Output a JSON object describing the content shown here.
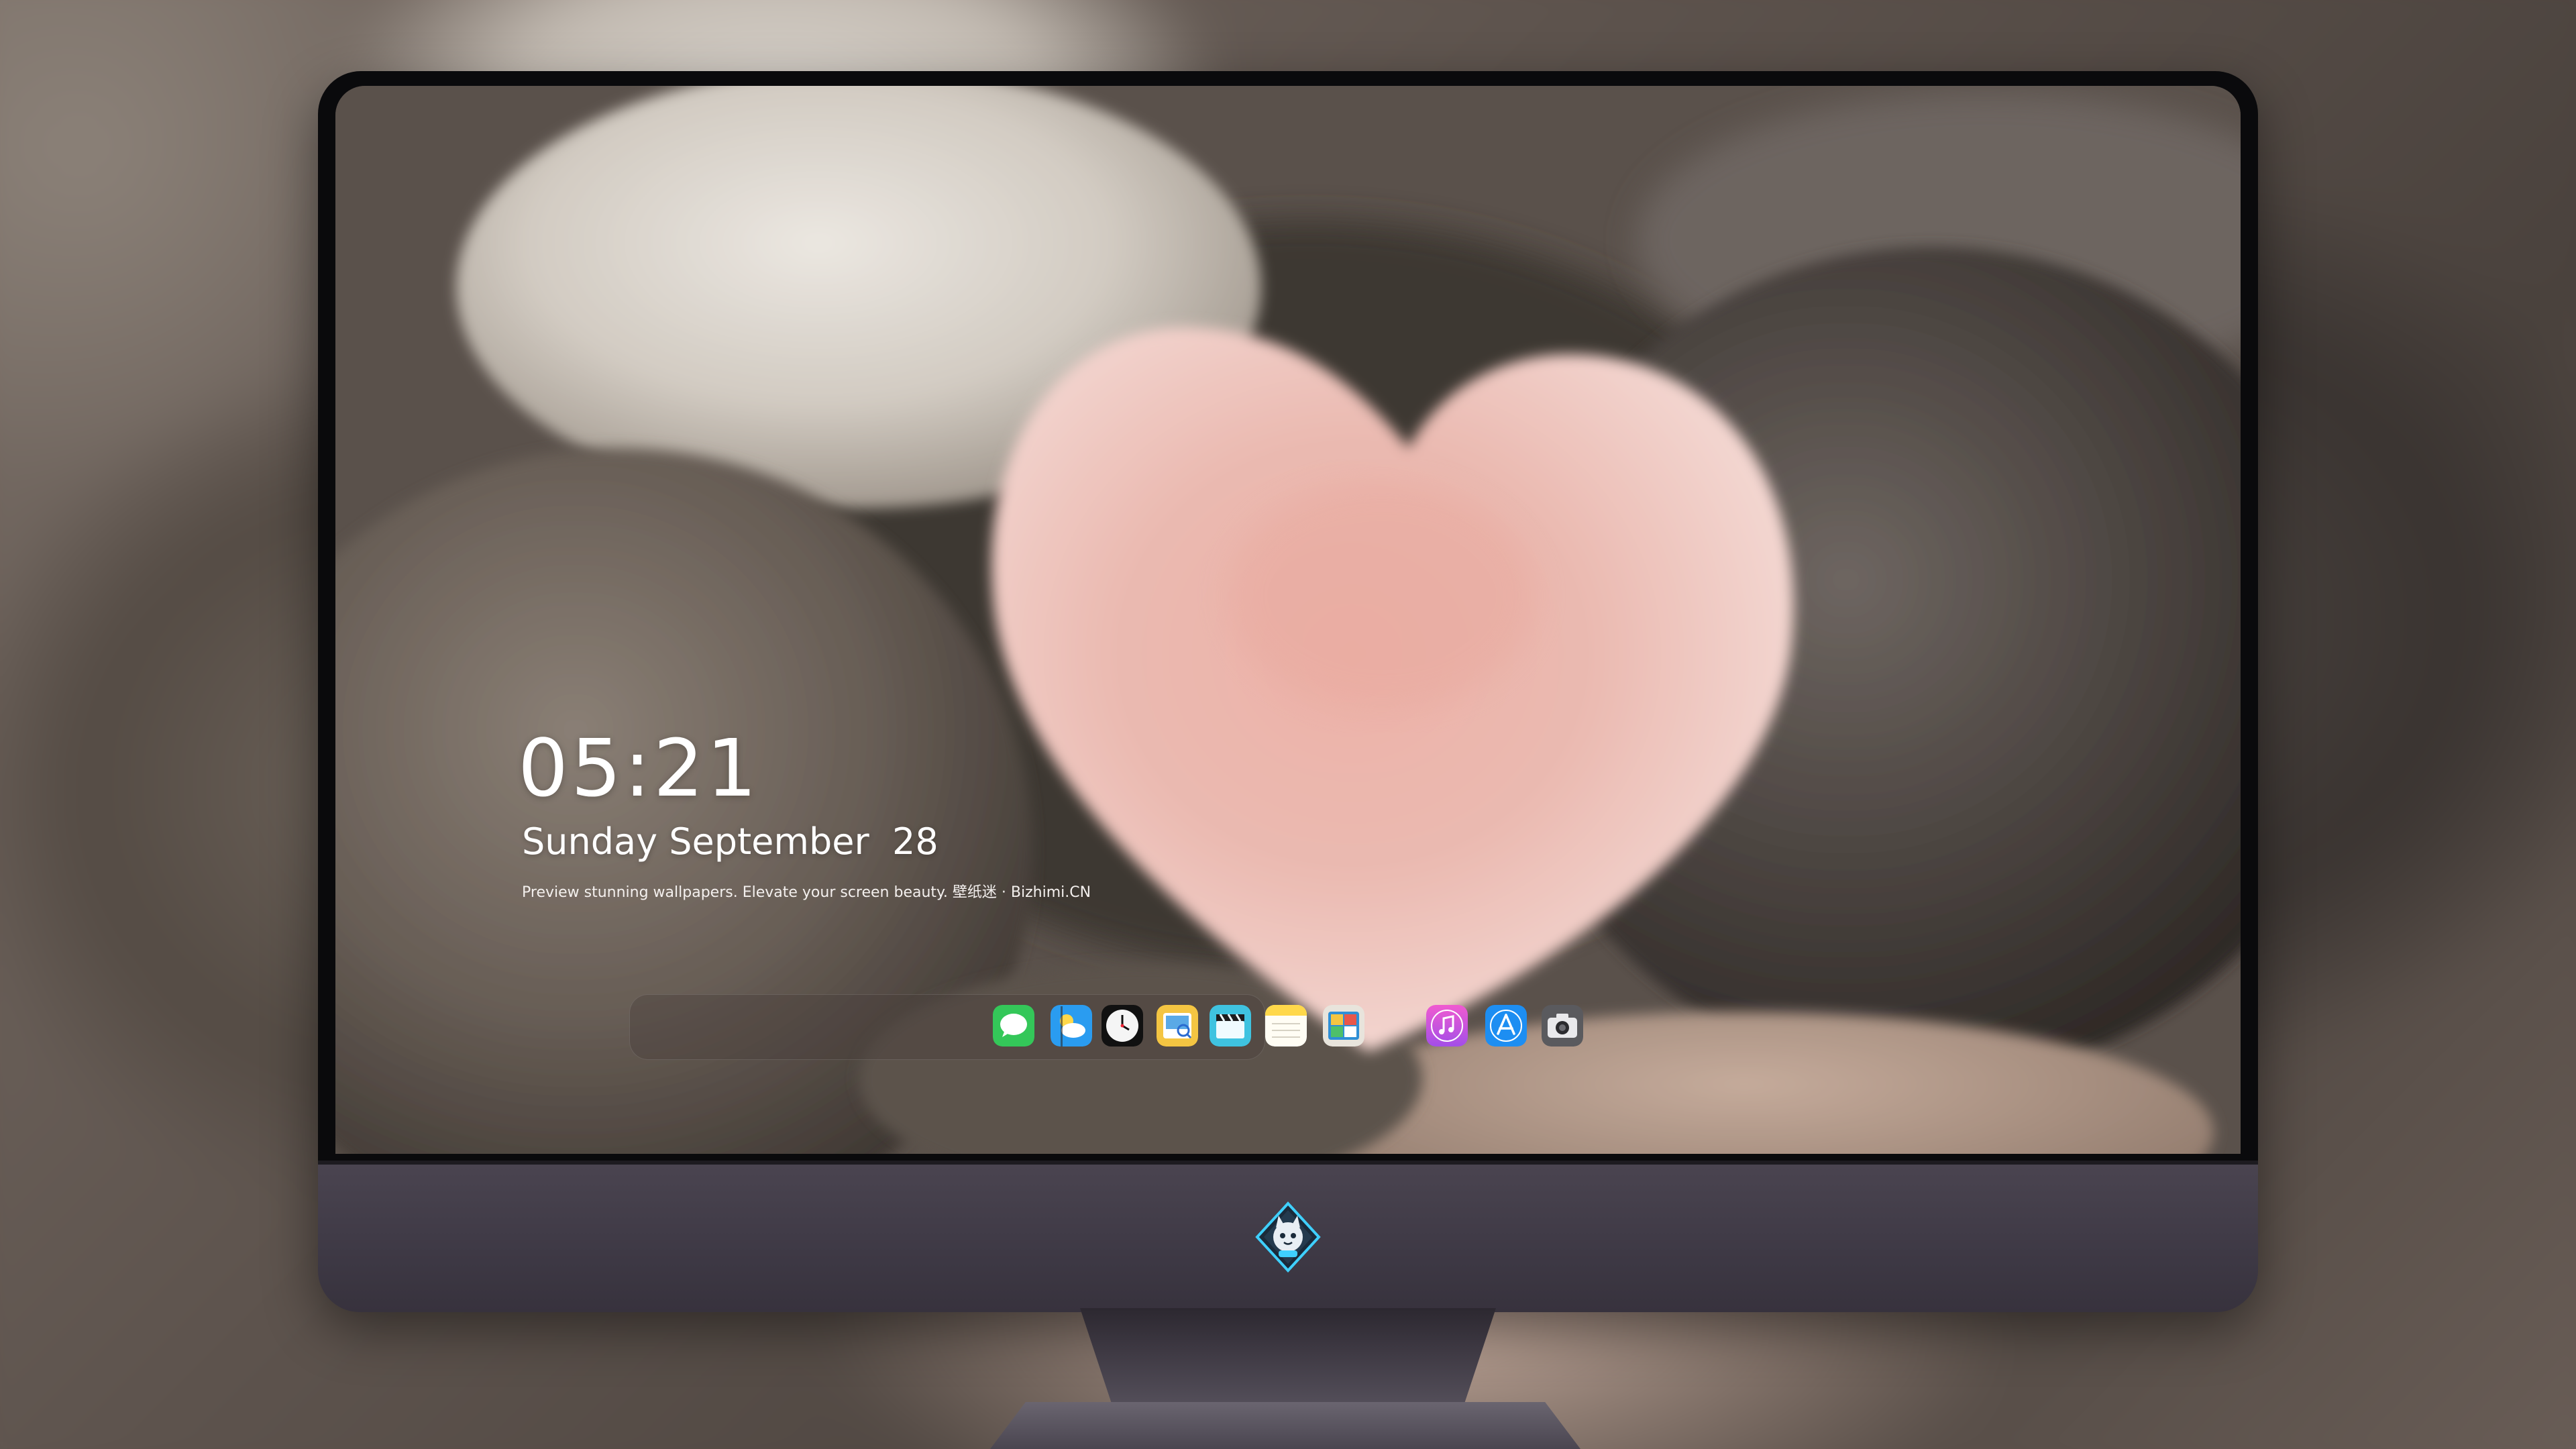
{
  "lock_screen": {
    "time": "05:21",
    "date": "Sunday September  28",
    "tagline": "Preview stunning wallpapers. Elevate your screen beauty. 壁纸迷 · Bizhimi.CN"
  },
  "dock": {
    "apps": [
      {
        "name": "messages",
        "icon": "messages-icon",
        "color": "#34c759"
      },
      {
        "name": "weather",
        "icon": "weather-icon",
        "color": "#2a9cf0"
      },
      {
        "name": "clock",
        "icon": "clock-icon",
        "color": "#111111"
      },
      {
        "name": "preview",
        "icon": "preview-icon",
        "color": "#f4c542"
      },
      {
        "name": "video-clips",
        "icon": "clapperboard-icon",
        "color": "#3fc3e0"
      },
      {
        "name": "notes",
        "icon": "notes-icon",
        "color": "#ffd84a"
      },
      {
        "name": "photo-booth",
        "icon": "photo-booth-icon",
        "color": "#e8e4dc"
      },
      {
        "name": "music",
        "icon": "music-icon",
        "color": "#d35bd8"
      },
      {
        "name": "app-store",
        "icon": "app-store-icon",
        "color": "#1d8ef2"
      },
      {
        "name": "camera",
        "icon": "camera-icon",
        "color": "#5a5a5e"
      }
    ]
  },
  "monitor": {
    "logo": "cat-mascot-logo"
  }
}
